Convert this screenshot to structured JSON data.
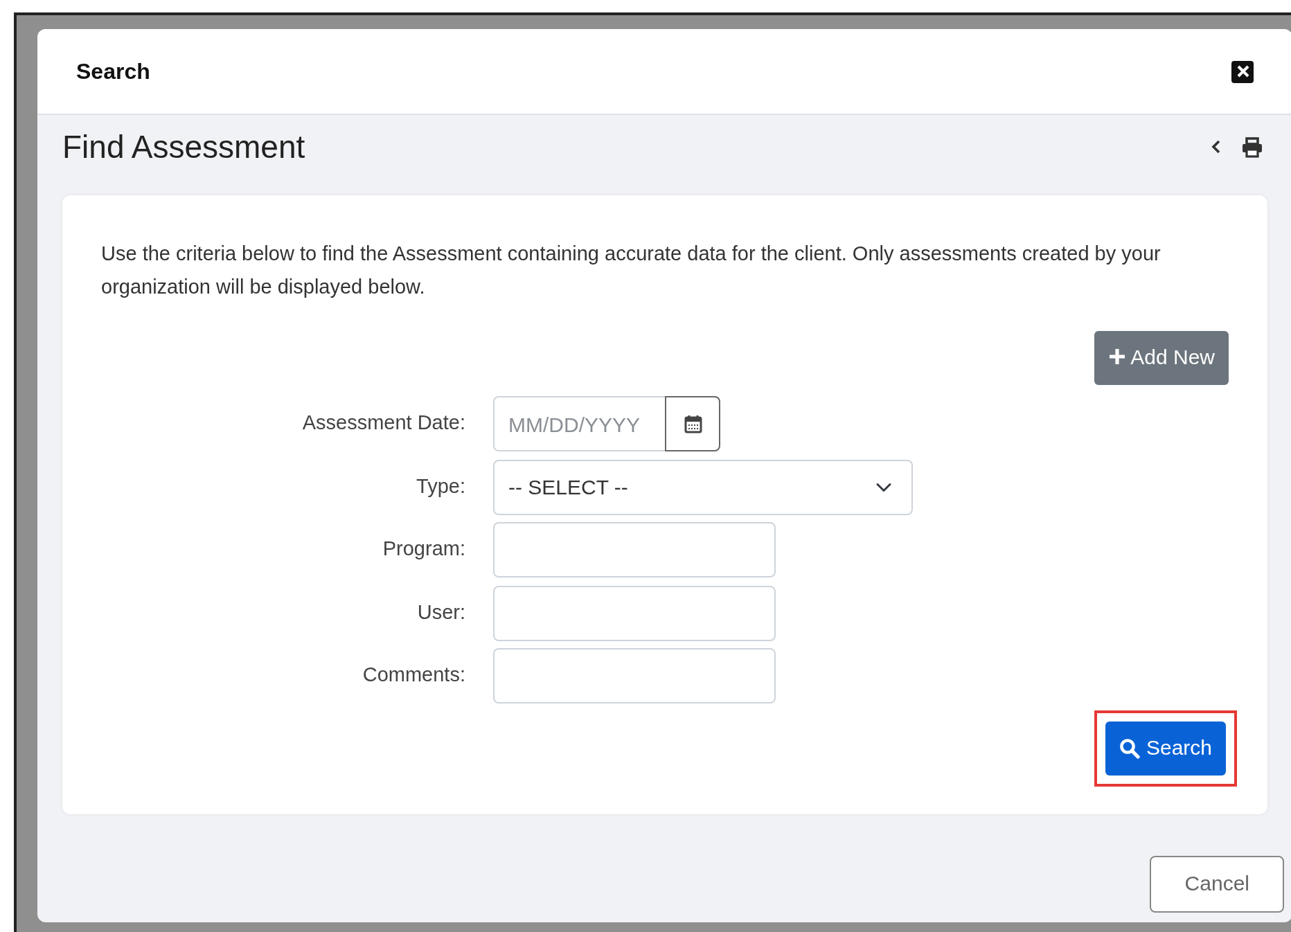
{
  "dialog": {
    "title": "Search"
  },
  "panel": {
    "title": "Find Assessment"
  },
  "intro": "Use the criteria below to find the Assessment containing accurate data for the client. Only assessments created by your organization will be displayed below.",
  "add_button": {
    "label": "Add New"
  },
  "fields": [
    {
      "kind": "date",
      "label": "Assessment Date:",
      "placeholder": "MM/DD/YYYY"
    },
    {
      "kind": "select",
      "label": "Type:",
      "value": "-- SELECT --"
    },
    {
      "kind": "text",
      "label": "Program:"
    },
    {
      "kind": "text",
      "label": "User:"
    },
    {
      "kind": "text",
      "label": "Comments:"
    }
  ],
  "search_button": {
    "label": "Search",
    "highlighted": true
  },
  "cancel_button": {
    "label": "Cancel"
  }
}
